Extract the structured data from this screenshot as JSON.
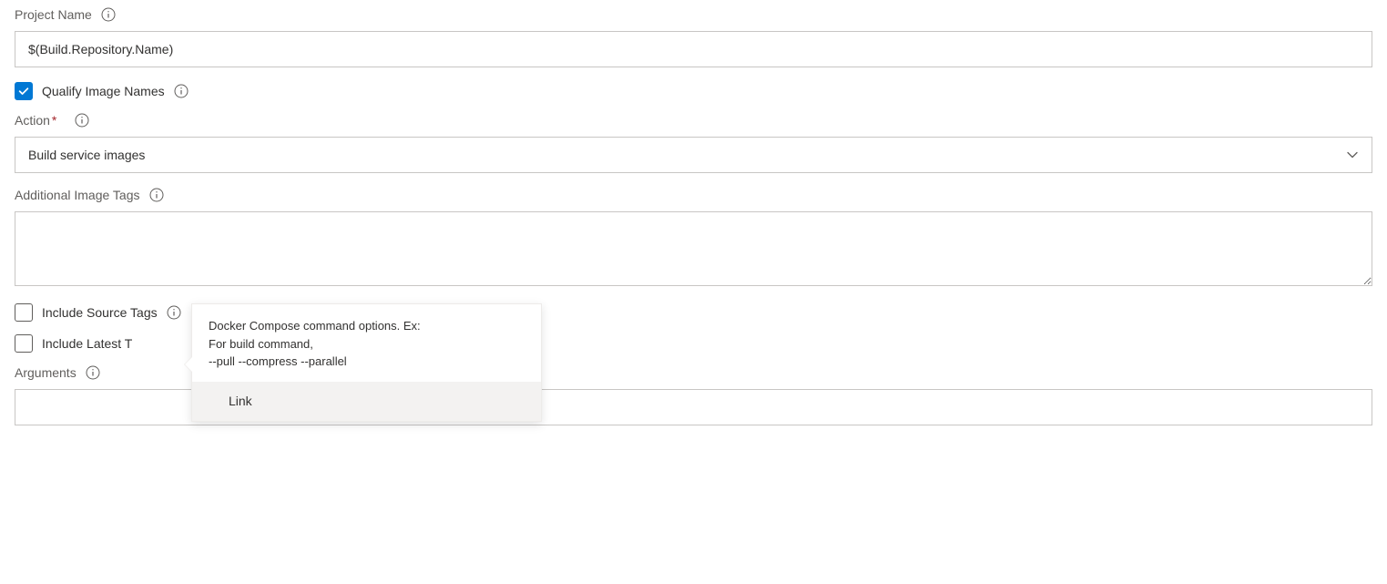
{
  "projectName": {
    "label": "Project Name",
    "value": "$(Build.Repository.Name)"
  },
  "qualifyImageNames": {
    "label": "Qualify Image Names",
    "checked": true
  },
  "action": {
    "label": "Action",
    "required": "*",
    "selected": "Build service images"
  },
  "additionalImageTags": {
    "label": "Additional Image Tags",
    "value": ""
  },
  "includeSourceTags": {
    "label": "Include Source Tags",
    "checked": false
  },
  "includeLatestTag": {
    "label": "Include Latest T",
    "checked": false
  },
  "arguments": {
    "label": "Arguments",
    "value": "",
    "tooltip": {
      "line1": "Docker Compose command options. Ex:",
      "line2": "For build command,",
      "line3": "--pull --compress --parallel",
      "link": "Link"
    }
  }
}
